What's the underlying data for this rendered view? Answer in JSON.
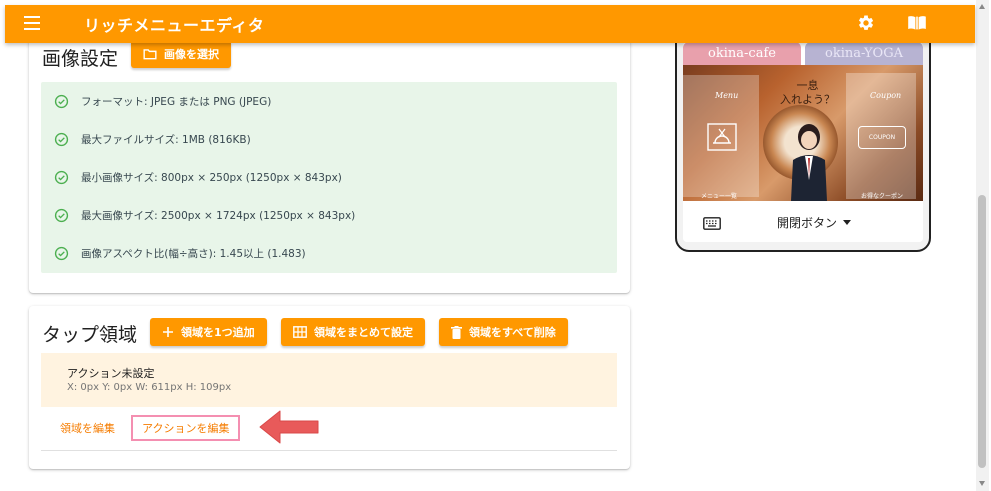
{
  "app": {
    "title": "リッチメニューエディタ"
  },
  "image_settings": {
    "title": "画像設定",
    "select_button": "画像を選択",
    "checks": [
      "フォーマット: JPEG または PNG (JPEG)",
      "最大ファイルサイズ: 1MB (816KB)",
      "最小画像サイズ: 800px × 250px (1250px × 843px)",
      "最大画像サイズ: 2500px × 1724px (1250px × 843px)",
      "画像アスペクト比(幅÷高さ): 1.45以上 (1.483)"
    ]
  },
  "tap_area": {
    "title": "タップ領域",
    "add_button": "領域を1つ追加",
    "bulk_button": "領域をまとめて設定",
    "delete_button": "領域をすべて削除",
    "action_status": "アクション未設定",
    "coords": "X: 0px Y: 0px W: 611px H: 109px",
    "edit_area": "領域を編集",
    "edit_action": "アクションを編集"
  },
  "preview": {
    "tab_1": "okina-cafe",
    "tab_2": "okina-YOGA",
    "menu_label": "Menu",
    "coupon_label": "Coupon",
    "coupon_box": "COUPON",
    "caption_left": "メニュー一覧",
    "caption_right": "お得なクーポン",
    "headline_1": "一息",
    "headline_2": "入れよう？",
    "toggle_label": "開閉ボタン"
  },
  "colors": {
    "accent": "#ff9800",
    "success_bg": "#e8f5e9",
    "success_icon": "#4caf50",
    "warning_bg": "#fff3e0",
    "highlight": "#f48fb1",
    "arrow": "#e85a5a"
  }
}
